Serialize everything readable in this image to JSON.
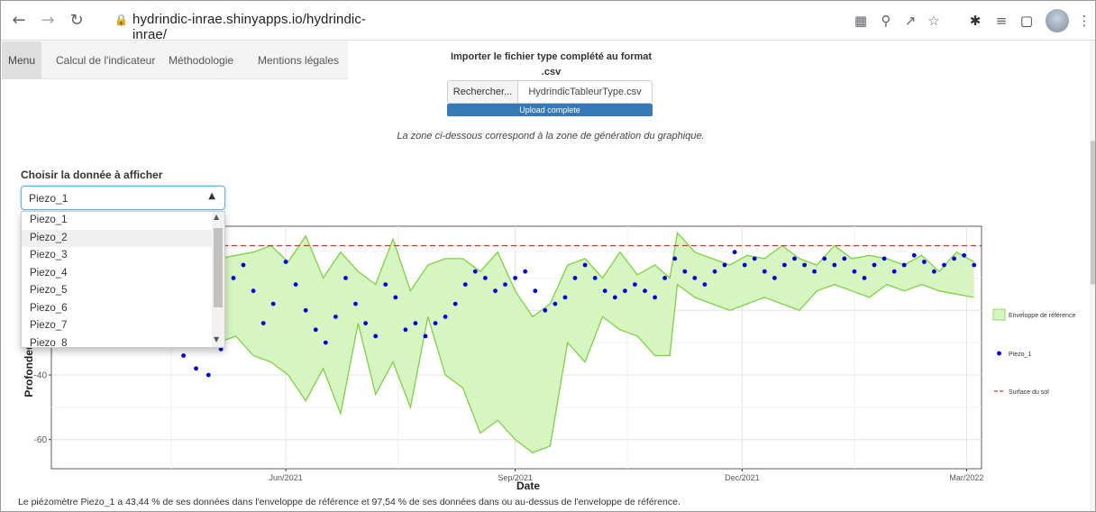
{
  "browser": {
    "url": "hydrindic-inrae.shinyapps.io/hydrindic-inrae/",
    "icons": [
      "back-arrow-icon",
      "forward-arrow-icon",
      "reload-icon",
      "lock-icon",
      "translate-icon",
      "zoom-icon",
      "share-icon",
      "star-icon",
      "extension-icon",
      "reading-list-icon",
      "side-panel-icon",
      "profile-avatar",
      "more-menu-icon"
    ]
  },
  "navbar": {
    "items": [
      "Menu",
      "Calcul de l'indicateur",
      "Méthodologie",
      "Mentions légales"
    ],
    "active": "Menu"
  },
  "upload": {
    "title": "Importer le fichier type complété au format .csv",
    "browse_label": "Rechercher...",
    "file_name": "HydrindicTableurType.csv",
    "progress_text": "Upload complete",
    "progress": 100
  },
  "zone_note": "La zone ci-dessous correspond à la zone de génération du graphique.",
  "select": {
    "label": "Choisir la donnée à afficher",
    "value": "Piezo_1",
    "options": [
      "Piezo_1",
      "Piezo_2",
      "Piezo_3",
      "Piezo_4",
      "Piezo_5",
      "Piezo_6",
      "Piezo_7",
      "Piezo_8"
    ],
    "highlighted": "Piezo_2"
  },
  "chart_data": {
    "type": "line",
    "xlabel": "Date",
    "ylabel": "Profondeur d",
    "x_ticks": [
      "Jun/2021",
      "Sep/2021",
      "Dec/2021",
      "Mar/2022"
    ],
    "y_ticks": [
      -40,
      -60
    ],
    "xlim": [
      "2021-02-27",
      "2022-03-07"
    ],
    "ylim": [
      -69,
      6
    ],
    "grid": true,
    "legend_position": "right",
    "legend": [
      {
        "name": "Enveloppe de référence",
        "kind": "ribbon",
        "fill": "#d6f5c0",
        "stroke": "#7bd341"
      },
      {
        "name": "Piezo_1",
        "kind": "points",
        "color": "#0000e6"
      },
      {
        "name": "Surface du sol",
        "kind": "dashed-line",
        "color": "#c0392b"
      }
    ],
    "surface_level": 0,
    "envelope": {
      "x": [
        "2021-03-01",
        "2021-03-11",
        "2021-03-21",
        "2021-03-31",
        "2021-04-10",
        "2021-04-20",
        "2021-04-28",
        "2021-05-05",
        "2021-05-12",
        "2021-05-19",
        "2021-05-26",
        "2021-06-02",
        "2021-06-09",
        "2021-06-16",
        "2021-06-23",
        "2021-06-30",
        "2021-07-07",
        "2021-07-14",
        "2021-07-21",
        "2021-07-28",
        "2021-08-04",
        "2021-08-11",
        "2021-08-18",
        "2021-08-25",
        "2021-09-01",
        "2021-09-08",
        "2021-09-15",
        "2021-09-22",
        "2021-09-29",
        "2021-10-06",
        "2021-10-13",
        "2021-10-20",
        "2021-10-27",
        "2021-11-02",
        "2021-11-05",
        "2021-11-12",
        "2021-11-19",
        "2021-11-26",
        "2021-12-03",
        "2021-12-10",
        "2021-12-17",
        "2021-12-24",
        "2021-12-31",
        "2022-01-07",
        "2022-01-14",
        "2022-01-21",
        "2022-01-28",
        "2022-02-04",
        "2022-02-11",
        "2022-02-18",
        "2022-02-25",
        "2022-03-04"
      ],
      "upper": [
        -1,
        2,
        -3,
        -6,
        -4,
        -8,
        -6,
        -4,
        -3,
        -2,
        0,
        -5,
        3,
        -10,
        -2,
        -8,
        -12,
        2,
        -14,
        -6,
        -4,
        -4,
        -8,
        -2,
        -14,
        -22,
        -18,
        -6,
        -4,
        -10,
        -2,
        -9,
        -6,
        -10,
        4,
        -2,
        -4,
        -6,
        -3,
        -4,
        0,
        -4,
        -6,
        0,
        -4,
        -3,
        -4,
        -6,
        -3,
        -8,
        -2,
        -5
      ],
      "lower": [
        -6,
        -10,
        -12,
        -16,
        -18,
        -22,
        -26,
        -30,
        -28,
        -34,
        -36,
        -40,
        -48,
        -38,
        -52,
        -24,
        -46,
        -36,
        -50,
        -22,
        -40,
        -44,
        -58,
        -54,
        -60,
        -64,
        -62,
        -30,
        -36,
        -22,
        -26,
        -28,
        -34,
        -34,
        -12,
        -16,
        -18,
        -20,
        -18,
        -16,
        -18,
        -20,
        -14,
        -12,
        -14,
        -16,
        -12,
        -14,
        -12,
        -14,
        -15,
        -16
      ]
    },
    "series": [
      {
        "name": "Piezo_1",
        "x": [
          "2021-03-02",
          "2021-03-07",
          "2021-03-12",
          "2021-03-17",
          "2021-03-22",
          "2021-03-27",
          "2021-04-01",
          "2021-04-06",
          "2021-04-11",
          "2021-04-16",
          "2021-04-21",
          "2021-04-26",
          "2021-05-01",
          "2021-05-06",
          "2021-05-11",
          "2021-05-15",
          "2021-05-19",
          "2021-05-23",
          "2021-05-27",
          "2021-06-01",
          "2021-06-05",
          "2021-06-09",
          "2021-06-13",
          "2021-06-17",
          "2021-06-21",
          "2021-06-25",
          "2021-06-29",
          "2021-07-03",
          "2021-07-07",
          "2021-07-11",
          "2021-07-15",
          "2021-07-19",
          "2021-07-23",
          "2021-07-27",
          "2021-07-31",
          "2021-08-04",
          "2021-08-08",
          "2021-08-12",
          "2021-08-16",
          "2021-08-20",
          "2021-08-24",
          "2021-08-28",
          "2021-09-01",
          "2021-09-05",
          "2021-09-09",
          "2021-09-13",
          "2021-09-17",
          "2021-09-21",
          "2021-09-25",
          "2021-09-29",
          "2021-10-03",
          "2021-10-07",
          "2021-10-11",
          "2021-10-15",
          "2021-10-19",
          "2021-10-23",
          "2021-10-27",
          "2021-10-31",
          "2021-11-04",
          "2021-11-08",
          "2021-11-12",
          "2021-11-16",
          "2021-11-20",
          "2021-11-24",
          "2021-11-28",
          "2021-12-02",
          "2021-12-06",
          "2021-12-10",
          "2021-12-14",
          "2021-12-18",
          "2021-12-22",
          "2021-12-26",
          "2021-12-30",
          "2022-01-03",
          "2022-01-07",
          "2022-01-11",
          "2022-01-15",
          "2022-01-19",
          "2022-01-23",
          "2022-01-27",
          "2022-01-31",
          "2022-02-04",
          "2022-02-08",
          "2022-02-12",
          "2022-02-16",
          "2022-02-20",
          "2022-02-24",
          "2022-02-28",
          "2022-03-04"
        ],
        "y": [
          -2,
          -3,
          -2,
          -4,
          -5,
          -8,
          -12,
          -18,
          -22,
          -28,
          -34,
          -38,
          -40,
          -32,
          -10,
          -6,
          -14,
          -24,
          -18,
          -5,
          -12,
          -20,
          -26,
          -30,
          -22,
          -10,
          -18,
          -24,
          -28,
          -12,
          -16,
          -26,
          -24,
          -28,
          -24,
          -22,
          -18,
          -12,
          -8,
          -10,
          -14,
          -12,
          -10,
          -8,
          -14,
          -20,
          -18,
          -16,
          -10,
          -6,
          -10,
          -14,
          -16,
          -14,
          -12,
          -14,
          -16,
          -10,
          -4,
          -8,
          -10,
          -12,
          -8,
          -6,
          -2,
          -6,
          -4,
          -8,
          -10,
          -6,
          -4,
          -6,
          -8,
          -4,
          -6,
          -4,
          -8,
          -10,
          -6,
          -4,
          -8,
          -6,
          -3,
          -5,
          -8,
          -6,
          -4,
          -3,
          -6
        ]
      }
    ]
  },
  "summary": "Le piézomètre Piezo_1 a 43,44 % de ses données dans l'enveloppe de référence et 97,54 % de ses données dans ou au-dessus de l'enveloppe de référence."
}
